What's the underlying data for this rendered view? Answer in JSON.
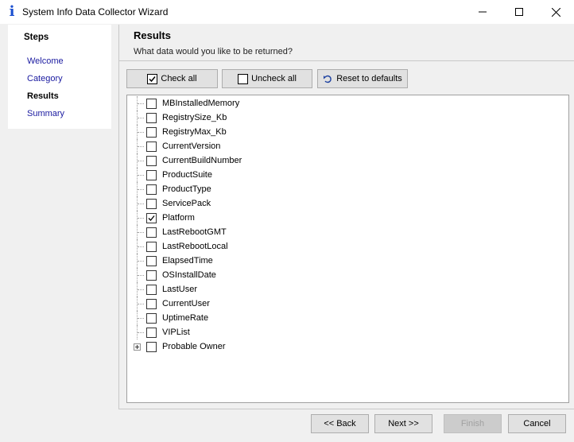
{
  "window": {
    "title": "System Info Data Collector Wizard",
    "icon": "info-icon"
  },
  "sidebar": {
    "title": "Steps",
    "items": [
      {
        "label": "Welcome",
        "active": false
      },
      {
        "label": "Category",
        "active": false
      },
      {
        "label": "Results",
        "active": true
      },
      {
        "label": "Summary",
        "active": false
      }
    ]
  },
  "header": {
    "title": "Results",
    "subtitle": "What data would you like to be returned?"
  },
  "toolbar": {
    "check_all": "Check all",
    "uncheck_all": "Uncheck all",
    "reset": "Reset to defaults"
  },
  "tree": {
    "items": [
      {
        "label": "MBInstalledMemory",
        "checked": false
      },
      {
        "label": "RegistrySize_Kb",
        "checked": false
      },
      {
        "label": "RegistryMax_Kb",
        "checked": false
      },
      {
        "label": "CurrentVersion",
        "checked": false
      },
      {
        "label": "CurrentBuildNumber",
        "checked": false
      },
      {
        "label": "ProductSuite",
        "checked": false
      },
      {
        "label": "ProductType",
        "checked": false
      },
      {
        "label": "ServicePack",
        "checked": false
      },
      {
        "label": "Platform",
        "checked": true
      },
      {
        "label": "LastRebootGMT",
        "checked": false
      },
      {
        "label": "LastRebootLocal",
        "checked": false
      },
      {
        "label": "ElapsedTime",
        "checked": false
      },
      {
        "label": "OSInstallDate",
        "checked": false
      },
      {
        "label": "LastUser",
        "checked": false
      },
      {
        "label": "CurrentUser",
        "checked": false
      },
      {
        "label": "UptimeRate",
        "checked": false
      },
      {
        "label": "VIPList",
        "checked": false
      },
      {
        "label": "Probable Owner",
        "checked": false,
        "expandable": true
      }
    ]
  },
  "footer": {
    "back": "<< Back",
    "next": "Next >>",
    "finish": "Finish",
    "cancel": "Cancel"
  }
}
